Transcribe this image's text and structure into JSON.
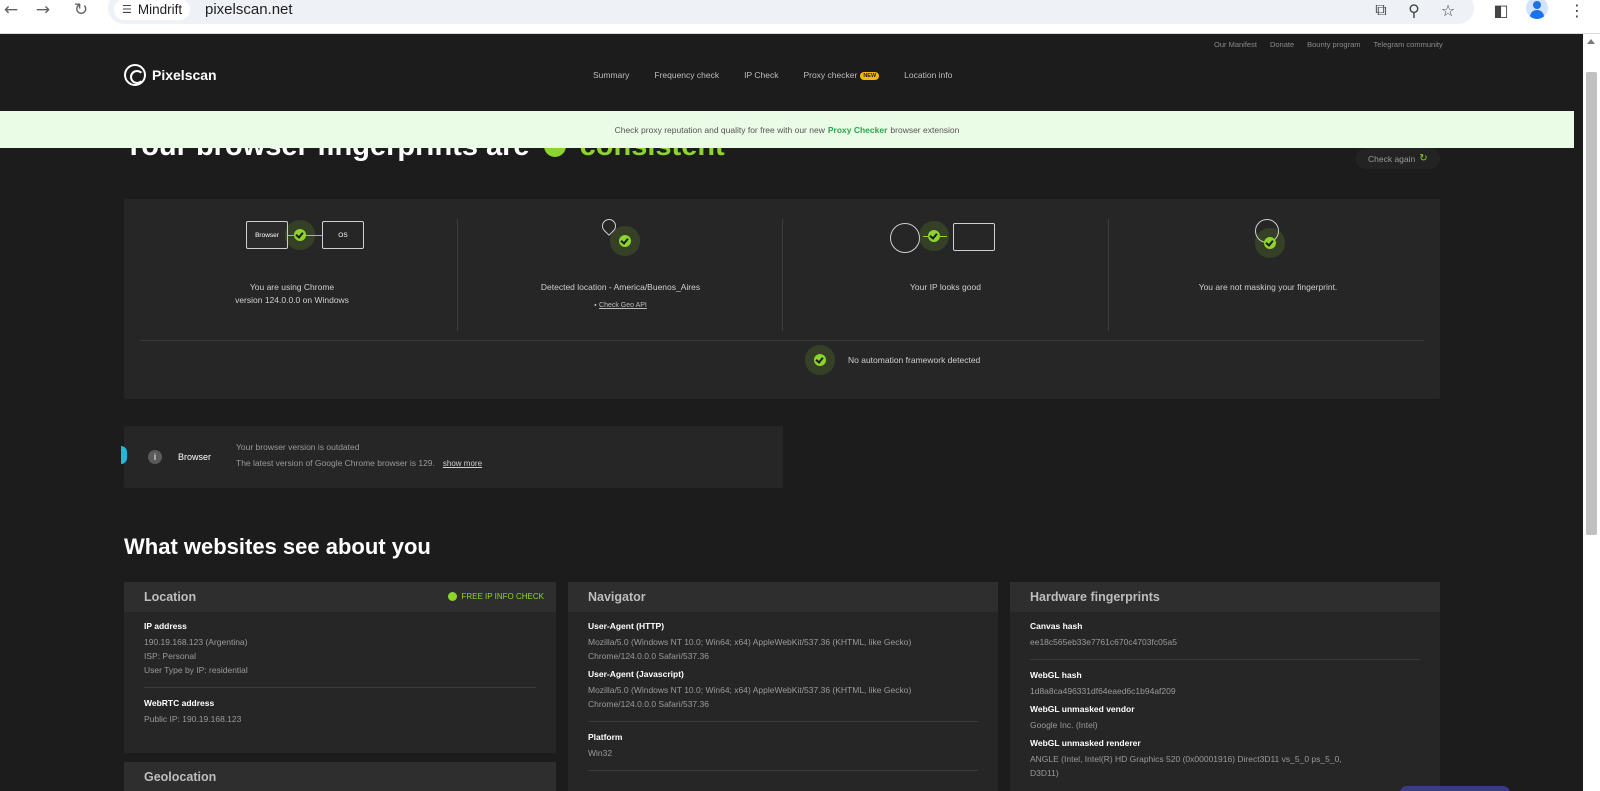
{
  "browser": {
    "site_chip": "Mindrift",
    "url": "pixelscan.net"
  },
  "top_links": [
    "Our Manifest",
    "Donate",
    "Bounty program",
    "Telegram community"
  ],
  "header": {
    "logo": "Pixelscan",
    "nav": [
      "Summary",
      "Frequency check",
      "IP Check",
      "Proxy checker",
      "Location info"
    ],
    "new_badge": "NEW"
  },
  "banner": {
    "before": "Check proxy reputation and quality for free with our new",
    "link": "Proxy Checker",
    "after": "browser extension"
  },
  "hero": {
    "title": "Your browser fingerprints are",
    "status": "consistent",
    "check_again": "Check again"
  },
  "summary": {
    "browser_box": "Browser",
    "os_box": "OS",
    "browser_text_1": "You are using Chrome",
    "browser_text_2": "version 124.0.0.0 on Windows",
    "location_text": "Detected location - America/Buenos_Aires",
    "geo_link": "Check Geo API",
    "ip_text": "Your IP looks good",
    "fingerprint_text": "You are not masking your fingerprint.",
    "automation_text": "No automation framework detected"
  },
  "warning": {
    "label": "Browser",
    "line1": "Your browser version is outdated",
    "line2": "The latest version of Google Chrome browser is 129.",
    "show_more": "show more"
  },
  "section_title": "What websites see about you",
  "location_card": {
    "title": "Location",
    "free_ip": "FREE IP INFO CHECK",
    "ip_label": "IP address",
    "ip_value": "190.19.168.123 (Argentina)",
    "isp": "ISP: Personal",
    "user_type": "User Type by IP: residential",
    "webrtc_label": "WebRTC address",
    "webrtc_value": "Public IP: 190.19.168.123"
  },
  "geolocation_card": {
    "title": "Geolocation"
  },
  "navigator_card": {
    "title": "Navigator",
    "ua_http_label": "User-Agent (HTTP)",
    "ua_http_1": "Mozilla/5.0 (Windows NT 10.0; Win64; x64) AppleWebKit/537.36 (KHTML, like Gecko)",
    "ua_http_2": "Chrome/124.0.0.0 Safari/537.36",
    "ua_js_label": "User-Agent (Javascript)",
    "ua_js_1": "Mozilla/5.0 (Windows NT 10.0; Win64; x64) AppleWebKit/537.36 (KHTML, like Gecko)",
    "ua_js_2": "Chrome/124.0.0.0 Safari/537.36",
    "platform_label": "Platform",
    "platform_value": "Win32"
  },
  "hardware_card": {
    "title": "Hardware fingerprints",
    "canvas_label": "Canvas hash",
    "canvas_value": "ee18c565eb33e7761c670c4703fc05a5",
    "webgl_label": "WebGL hash",
    "webgl_value": "1d8a8ca496331df64eaed6c1b94af209",
    "vendor_label": "WebGL unmasked vendor",
    "vendor_value": "Google Inc. (Intel)",
    "renderer_label": "WebGL unmasked renderer",
    "renderer_1": "ANGLE (Intel, Intel(R) HD Graphics 520 (0x00001916) Direct3D11 vs_5_0 ps_5_0,",
    "renderer_2": "D3D11)"
  }
}
